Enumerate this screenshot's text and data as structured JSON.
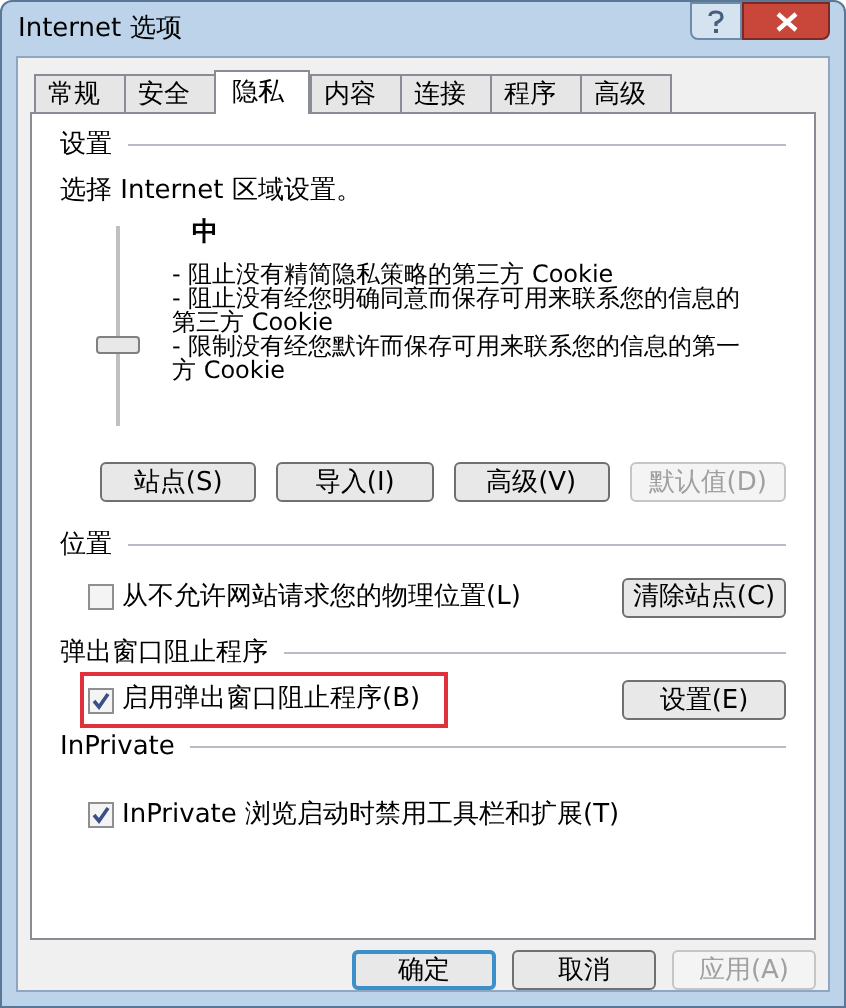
{
  "window": {
    "title": "Internet 选项"
  },
  "tabs": [
    {
      "label": "常规",
      "selected": false
    },
    {
      "label": "安全",
      "selected": false
    },
    {
      "label": "隐私",
      "selected": true
    },
    {
      "label": "内容",
      "selected": false
    },
    {
      "label": "连接",
      "selected": false
    },
    {
      "label": "程序",
      "selected": false
    },
    {
      "label": "高级",
      "selected": false
    }
  ],
  "settings": {
    "heading": "设置",
    "prompt": "选择 Internet 区域设置。",
    "level_name": "中",
    "slider": {
      "level": 0.4
    },
    "description": [
      "- 阻止没有精简隐私策略的第三方 Cookie",
      "- 阻止没有经您明确同意而保存可用来联系您的信息的第三方 Cookie",
      "- 限制没有经您默许而保存可用来联系您的信息的第一方 Cookie"
    ],
    "buttons": [
      {
        "label": "站点(S)",
        "disabled": false
      },
      {
        "label": "导入(I)",
        "disabled": false
      },
      {
        "label": "高级(V)",
        "disabled": false
      },
      {
        "label": "默认值(D)",
        "disabled": true
      }
    ]
  },
  "location": {
    "heading": "位置",
    "checkbox": {
      "label": "从不允许网站请求您的物理位置(L)",
      "checked": false,
      "highlighted": false
    },
    "button": {
      "label": "清除站点(C)",
      "disabled": false
    }
  },
  "popup_blocker": {
    "heading": "弹出窗口阻止程序",
    "checkbox": {
      "label": "启用弹出窗口阻止程序(B)",
      "checked": true,
      "highlighted": true
    },
    "button": {
      "label": "设置(E)",
      "disabled": false
    }
  },
  "inprivate": {
    "heading": "InPrivate",
    "checkbox": {
      "label": "InPrivate 浏览启动时禁用工具栏和扩展(T)",
      "checked": true,
      "highlighted": false
    }
  },
  "footer_buttons": [
    {
      "label": "确定",
      "default": true,
      "disabled": false
    },
    {
      "label": "取消",
      "default": false,
      "disabled": false
    },
    {
      "label": "应用(A)",
      "default": false,
      "disabled": true
    }
  ]
}
